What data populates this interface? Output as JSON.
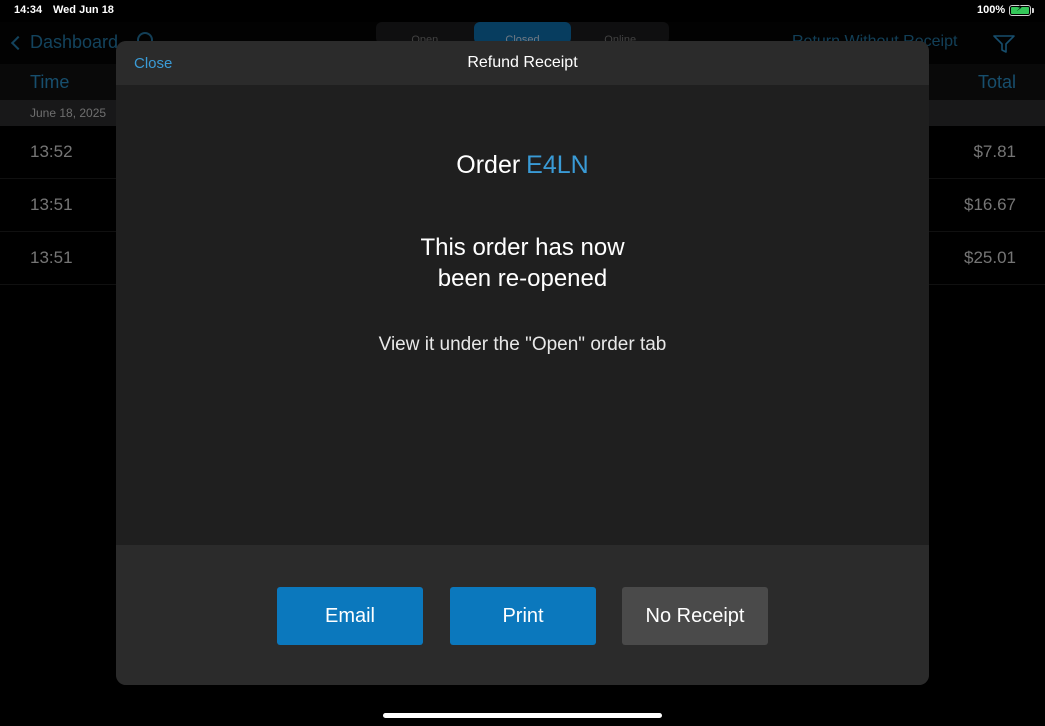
{
  "status_bar": {
    "time": "14:34",
    "date": "Wed Jun 18",
    "battery": "100%"
  },
  "nav": {
    "back_label": "Dashboard",
    "tabs": [
      {
        "label": "Open",
        "active": false
      },
      {
        "label": "Closed",
        "active": true
      },
      {
        "label": "Online",
        "active": false
      }
    ],
    "return_label": "Return Without Receipt"
  },
  "list": {
    "headers": {
      "time": "Time",
      "total": "Total"
    },
    "date": "June 18, 2025",
    "rows": [
      {
        "time": "13:52",
        "total": "$7.81"
      },
      {
        "time": "13:51",
        "total": "$16.67"
      },
      {
        "time": "13:51",
        "total": "$25.01"
      }
    ]
  },
  "modal": {
    "close_label": "Close",
    "title": "Refund Receipt",
    "order_prefix": "Order",
    "order_code": "E4LN",
    "message_line1": "This order has now",
    "message_line2": "been re-opened",
    "sub_message": "View it under the \"Open\" order tab",
    "buttons": {
      "email": "Email",
      "print": "Print",
      "no_receipt": "No Receipt"
    }
  },
  "colors": {
    "accent": "#3a9bd6",
    "button_primary": "#0b78bd",
    "button_secondary": "#4a4a4a"
  }
}
